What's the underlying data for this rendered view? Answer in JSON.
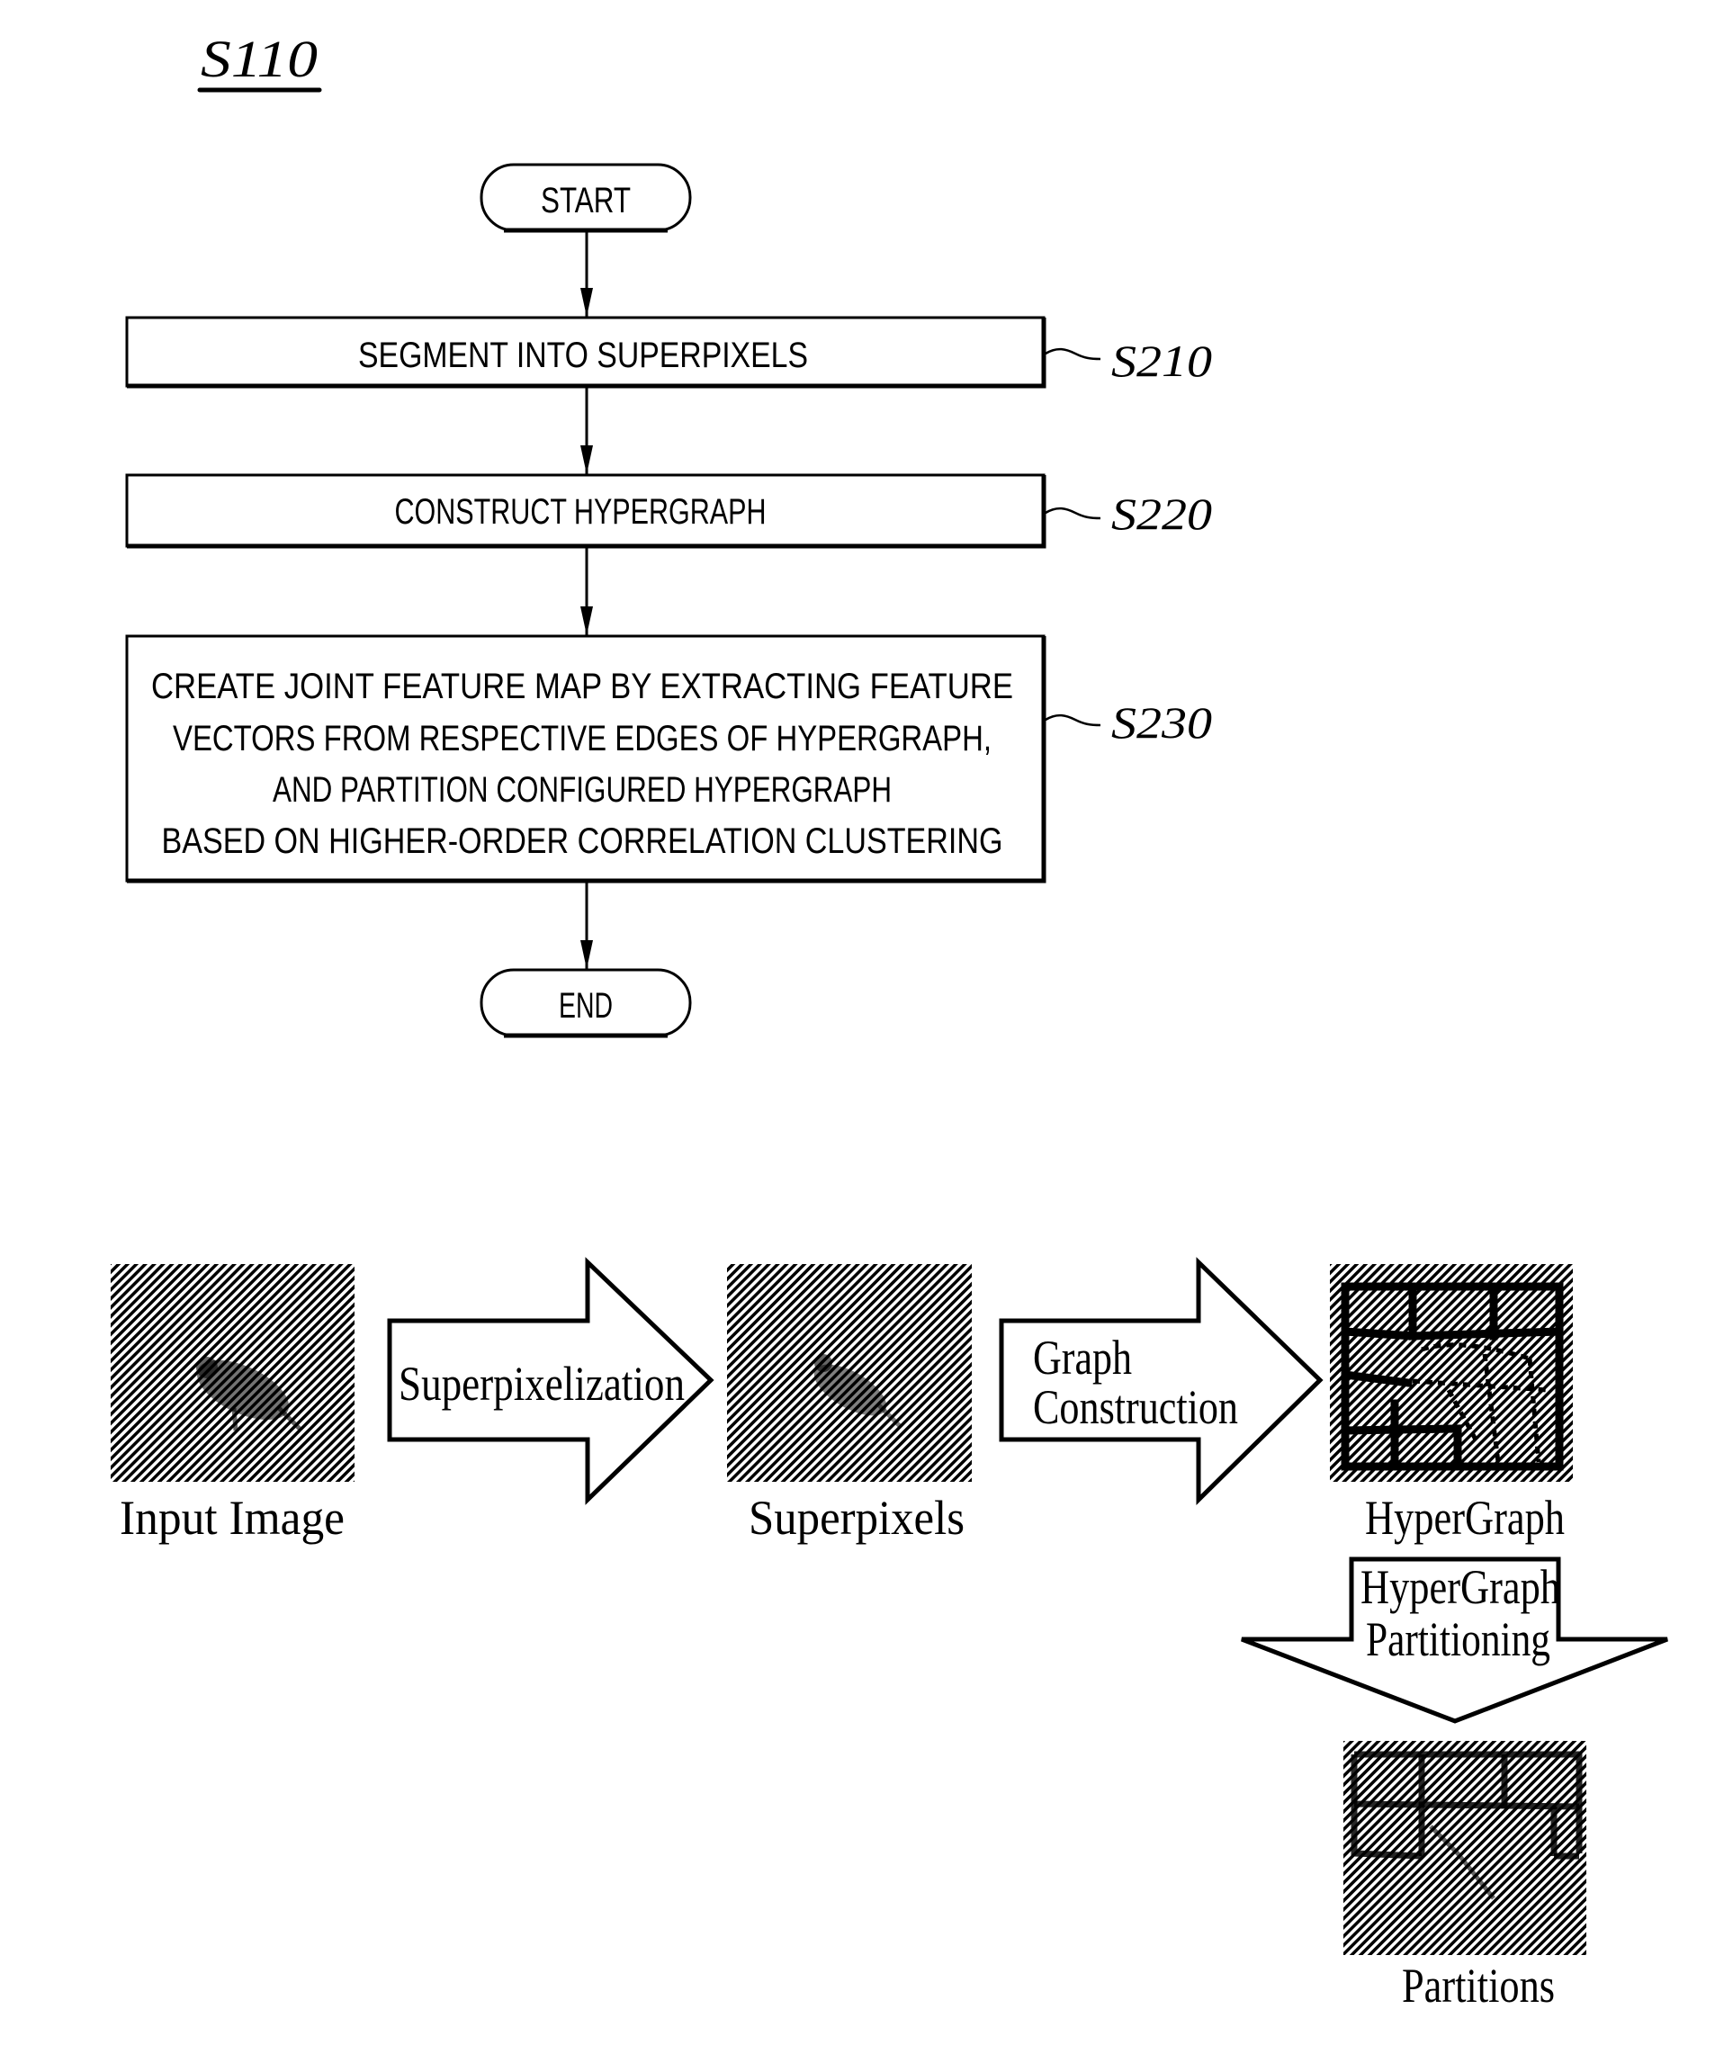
{
  "figure": {
    "label": "S110"
  },
  "flowchart": {
    "start_label": "START",
    "end_label": "END",
    "steps": [
      {
        "ref": "S210",
        "lines": [
          "SEGMENT  INTO  SUPERPIXELS"
        ]
      },
      {
        "ref": "S220",
        "lines": [
          "CONSTRUCT  HYPERGRAPH"
        ]
      },
      {
        "ref": "S230",
        "lines": [
          "CREATE JOINT FEATURE MAP BY EXTRACTING FEATURE",
          "VECTORS FROM RESPECTIVE EDGES OF HYPERGRAPH,",
          "AND PARTITION CONFIGURED HYPERGRAPH",
          "BASED ON HIGHER-ORDER CORRELATION CLUSTERING"
        ]
      }
    ]
  },
  "pipeline": {
    "stages": [
      {
        "id": "input",
        "label": "Input Image",
        "icon": "input-image-thumbnail"
      },
      {
        "id": "superpixels",
        "label": "Superpixels",
        "icon": "superpixels-thumbnail"
      },
      {
        "id": "hypergraph",
        "label": "HyperGraph",
        "icon": "hypergraph-thumbnail"
      },
      {
        "id": "partitions",
        "label": "Partitions",
        "icon": "partitions-thumbnail"
      }
    ],
    "arrows": [
      {
        "id": "superpixelization",
        "lines": [
          "Superpixelization"
        ]
      },
      {
        "id": "graph-construction",
        "lines": [
          "Graph",
          "Construction"
        ]
      },
      {
        "id": "hypergraph-partitioning",
        "lines": [
          "HyperGraph",
          "Partitioning"
        ]
      }
    ]
  }
}
